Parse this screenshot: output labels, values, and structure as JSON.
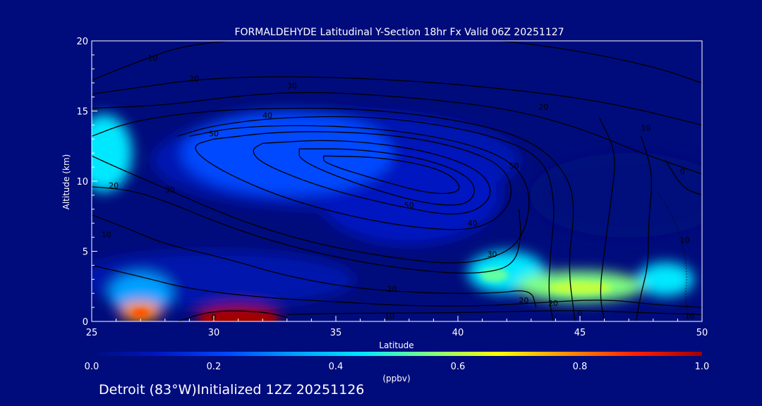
{
  "chart_data": {
    "type": "heatmap",
    "title": "FORMALDEHYDE Latitudinal Y-Section 18hr  Fx Valid 06Z 20251127",
    "xlabel": "Latitude",
    "ylabel": "Altitude (km)",
    "xlim": [
      25,
      50
    ],
    "ylim": [
      0,
      20
    ],
    "x_ticks": [
      "25",
      "30",
      "35",
      "40",
      "45",
      "50"
    ],
    "y_ticks": [
      "0",
      "5",
      "10",
      "15",
      "20"
    ],
    "colorbar": {
      "label": "(ppbv)",
      "range": [
        0.0,
        1.0
      ],
      "ticks": [
        "0.0",
        "0.2",
        "0.4",
        "0.6",
        "0.8",
        "1.0"
      ],
      "colors": [
        "#000c7c",
        "#0018c0",
        "#0048ff",
        "#00a0ff",
        "#00e8ff",
        "#80ff80",
        "#ffff00",
        "#ff9000",
        "#ff2000",
        "#a00000"
      ]
    },
    "field_features": [
      {
        "lat": 31,
        "alt": 0.3,
        "value": 1.0
      },
      {
        "lat": 27,
        "alt": 0.7,
        "value": 0.8
      },
      {
        "lat": 25.5,
        "alt": 12,
        "value": 0.45
      },
      {
        "lat": 45,
        "alt": 2.5,
        "value": 0.6
      },
      {
        "lat": 42,
        "alt": 3.5,
        "value": 0.45
      },
      {
        "lat": 48.5,
        "alt": 3.0,
        "value": 0.45
      },
      {
        "lat": 27,
        "alt": 2.0,
        "value": 0.3
      },
      {
        "lat": 33,
        "alt": 12,
        "value": 0.2
      },
      {
        "lat": 38,
        "alt": 9,
        "value": 0.15
      }
    ],
    "contour_labels": [
      {
        "lat": 27.5,
        "alt": 18.8,
        "text": "10"
      },
      {
        "lat": 29.2,
        "alt": 17.3,
        "text": "20"
      },
      {
        "lat": 33.2,
        "alt": 16.8,
        "text": "30"
      },
      {
        "lat": 32.2,
        "alt": 14.7,
        "text": "40"
      },
      {
        "lat": 30.0,
        "alt": 13.4,
        "text": "50"
      },
      {
        "lat": 42.3,
        "alt": 11.1,
        "text": "50"
      },
      {
        "lat": 38.0,
        "alt": 8.3,
        "text": "50"
      },
      {
        "lat": 40.6,
        "alt": 7.0,
        "text": "40"
      },
      {
        "lat": 41.4,
        "alt": 4.8,
        "text": "30"
      },
      {
        "lat": 25.9,
        "alt": 9.7,
        "text": "20"
      },
      {
        "lat": 28.2,
        "alt": 9.4,
        "text": "30"
      },
      {
        "lat": 25.6,
        "alt": 6.2,
        "text": "10"
      },
      {
        "lat": 37.3,
        "alt": 2.3,
        "text": "20"
      },
      {
        "lat": 37.2,
        "alt": 0.4,
        "text": "10"
      },
      {
        "lat": 42.7,
        "alt": 1.5,
        "text": "20"
      },
      {
        "lat": 43.9,
        "alt": 1.3,
        "text": "20"
      },
      {
        "lat": 45.0,
        "alt": 0.6,
        "text": "0"
      },
      {
        "lat": 49.5,
        "alt": 0.4,
        "text": "10"
      },
      {
        "lat": 43.5,
        "alt": 15.3,
        "text": "20"
      },
      {
        "lat": 47.7,
        "alt": 13.8,
        "text": "10"
      },
      {
        "lat": 49.2,
        "alt": 10.7,
        "text": "0"
      },
      {
        "lat": 49.3,
        "alt": 5.8,
        "text": "10"
      },
      {
        "lat": 30.0,
        "alt": 0.3,
        "text": "0"
      }
    ],
    "grid": false,
    "legend": "bottom"
  },
  "footer_text": "Detroit (83°W)Initialized 12Z 20251126"
}
